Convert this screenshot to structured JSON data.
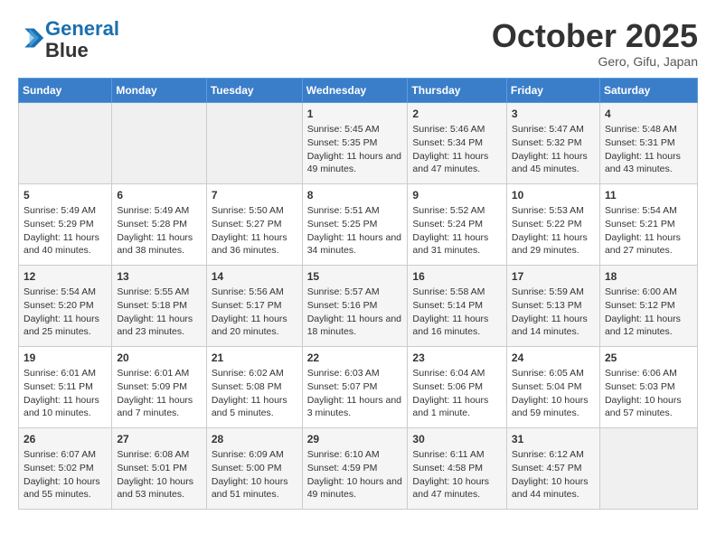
{
  "header": {
    "logo_line1": "General",
    "logo_line2": "Blue",
    "month": "October 2025",
    "location": "Gero, Gifu, Japan"
  },
  "weekdays": [
    "Sunday",
    "Monday",
    "Tuesday",
    "Wednesday",
    "Thursday",
    "Friday",
    "Saturday"
  ],
  "weeks": [
    [
      {
        "day": "",
        "empty": true
      },
      {
        "day": "",
        "empty": true
      },
      {
        "day": "",
        "empty": true
      },
      {
        "day": "1",
        "sun": "5:45 AM",
        "set": "5:35 PM",
        "daylight": "11 hours and 49 minutes."
      },
      {
        "day": "2",
        "sun": "5:46 AM",
        "set": "5:34 PM",
        "daylight": "11 hours and 47 minutes."
      },
      {
        "day": "3",
        "sun": "5:47 AM",
        "set": "5:32 PM",
        "daylight": "11 hours and 45 minutes."
      },
      {
        "day": "4",
        "sun": "5:48 AM",
        "set": "5:31 PM",
        "daylight": "11 hours and 43 minutes."
      }
    ],
    [
      {
        "day": "5",
        "sun": "5:49 AM",
        "set": "5:29 PM",
        "daylight": "11 hours and 40 minutes."
      },
      {
        "day": "6",
        "sun": "5:49 AM",
        "set": "5:28 PM",
        "daylight": "11 hours and 38 minutes."
      },
      {
        "day": "7",
        "sun": "5:50 AM",
        "set": "5:27 PM",
        "daylight": "11 hours and 36 minutes."
      },
      {
        "day": "8",
        "sun": "5:51 AM",
        "set": "5:25 PM",
        "daylight": "11 hours and 34 minutes."
      },
      {
        "day": "9",
        "sun": "5:52 AM",
        "set": "5:24 PM",
        "daylight": "11 hours and 31 minutes."
      },
      {
        "day": "10",
        "sun": "5:53 AM",
        "set": "5:22 PM",
        "daylight": "11 hours and 29 minutes."
      },
      {
        "day": "11",
        "sun": "5:54 AM",
        "set": "5:21 PM",
        "daylight": "11 hours and 27 minutes."
      }
    ],
    [
      {
        "day": "12",
        "sun": "5:54 AM",
        "set": "5:20 PM",
        "daylight": "11 hours and 25 minutes."
      },
      {
        "day": "13",
        "sun": "5:55 AM",
        "set": "5:18 PM",
        "daylight": "11 hours and 23 minutes."
      },
      {
        "day": "14",
        "sun": "5:56 AM",
        "set": "5:17 PM",
        "daylight": "11 hours and 20 minutes."
      },
      {
        "day": "15",
        "sun": "5:57 AM",
        "set": "5:16 PM",
        "daylight": "11 hours and 18 minutes."
      },
      {
        "day": "16",
        "sun": "5:58 AM",
        "set": "5:14 PM",
        "daylight": "11 hours and 16 minutes."
      },
      {
        "day": "17",
        "sun": "5:59 AM",
        "set": "5:13 PM",
        "daylight": "11 hours and 14 minutes."
      },
      {
        "day": "18",
        "sun": "6:00 AM",
        "set": "5:12 PM",
        "daylight": "11 hours and 12 minutes."
      }
    ],
    [
      {
        "day": "19",
        "sun": "6:01 AM",
        "set": "5:11 PM",
        "daylight": "11 hours and 10 minutes."
      },
      {
        "day": "20",
        "sun": "6:01 AM",
        "set": "5:09 PM",
        "daylight": "11 hours and 7 minutes."
      },
      {
        "day": "21",
        "sun": "6:02 AM",
        "set": "5:08 PM",
        "daylight": "11 hours and 5 minutes."
      },
      {
        "day": "22",
        "sun": "6:03 AM",
        "set": "5:07 PM",
        "daylight": "11 hours and 3 minutes."
      },
      {
        "day": "23",
        "sun": "6:04 AM",
        "set": "5:06 PM",
        "daylight": "11 hours and 1 minute."
      },
      {
        "day": "24",
        "sun": "6:05 AM",
        "set": "5:04 PM",
        "daylight": "10 hours and 59 minutes."
      },
      {
        "day": "25",
        "sun": "6:06 AM",
        "set": "5:03 PM",
        "daylight": "10 hours and 57 minutes."
      }
    ],
    [
      {
        "day": "26",
        "sun": "6:07 AM",
        "set": "5:02 PM",
        "daylight": "10 hours and 55 minutes."
      },
      {
        "day": "27",
        "sun": "6:08 AM",
        "set": "5:01 PM",
        "daylight": "10 hours and 53 minutes."
      },
      {
        "day": "28",
        "sun": "6:09 AM",
        "set": "5:00 PM",
        "daylight": "10 hours and 51 minutes."
      },
      {
        "day": "29",
        "sun": "6:10 AM",
        "set": "4:59 PM",
        "daylight": "10 hours and 49 minutes."
      },
      {
        "day": "30",
        "sun": "6:11 AM",
        "set": "4:58 PM",
        "daylight": "10 hours and 47 minutes."
      },
      {
        "day": "31",
        "sun": "6:12 AM",
        "set": "4:57 PM",
        "daylight": "10 hours and 44 minutes."
      },
      {
        "day": "",
        "empty": true
      }
    ]
  ]
}
